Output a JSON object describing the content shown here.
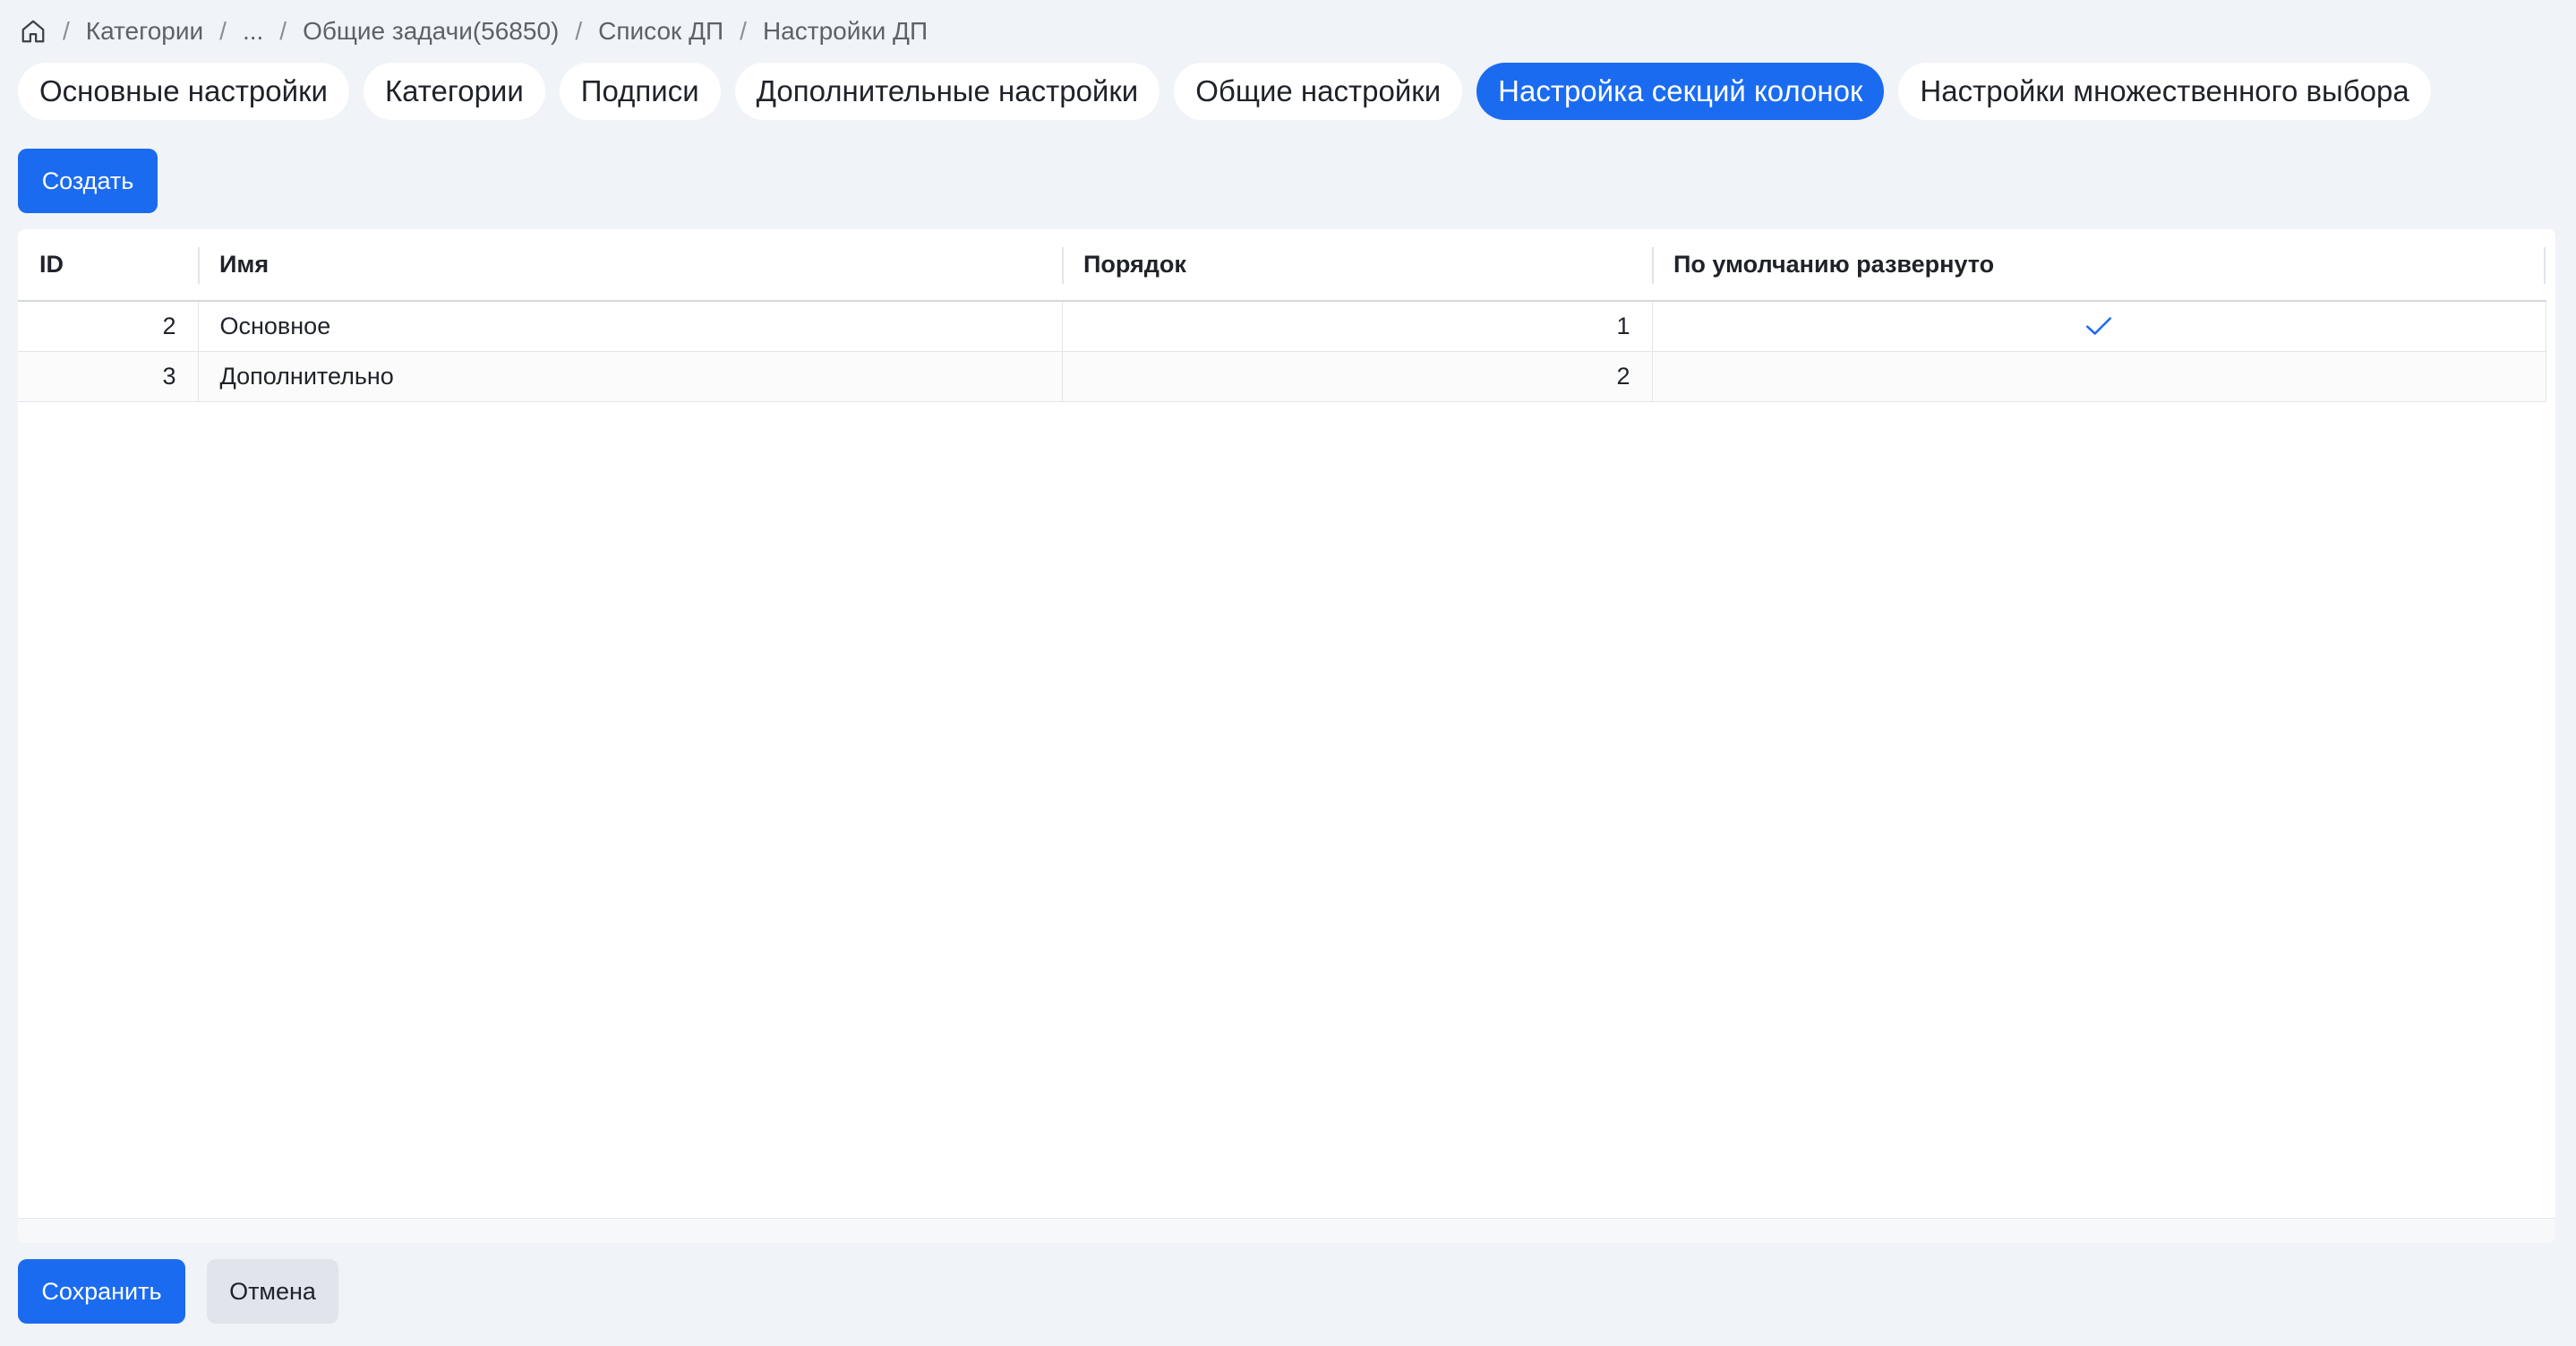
{
  "breadcrumb": {
    "home_icon": "home-icon",
    "items": [
      "Категории",
      "...",
      "Общие задачи(56850)",
      "Список ДП",
      "Настройки ДП"
    ]
  },
  "tabs": [
    {
      "label": "Основные настройки",
      "active": false
    },
    {
      "label": "Категории",
      "active": false
    },
    {
      "label": "Подписи",
      "active": false
    },
    {
      "label": "Дополнительные настройки",
      "active": false
    },
    {
      "label": "Общие настройки",
      "active": false
    },
    {
      "label": "Настройка секций колонок",
      "active": true
    },
    {
      "label": "Настройки множественного выбора",
      "active": false
    }
  ],
  "toolbar": {
    "create_label": "Создать"
  },
  "table": {
    "columns": [
      "ID",
      "Имя",
      "Порядок",
      "По умолчанию развернуто"
    ],
    "rows": [
      {
        "id": "2",
        "name": "Основное",
        "order": "1",
        "expanded": true
      },
      {
        "id": "3",
        "name": "Дополнительно",
        "order": "2",
        "expanded": false
      }
    ]
  },
  "footer": {
    "save_label": "Сохранить",
    "cancel_label": "Отмена"
  },
  "colors": {
    "accent": "#1a6bf0",
    "background": "#f0f3f7"
  }
}
